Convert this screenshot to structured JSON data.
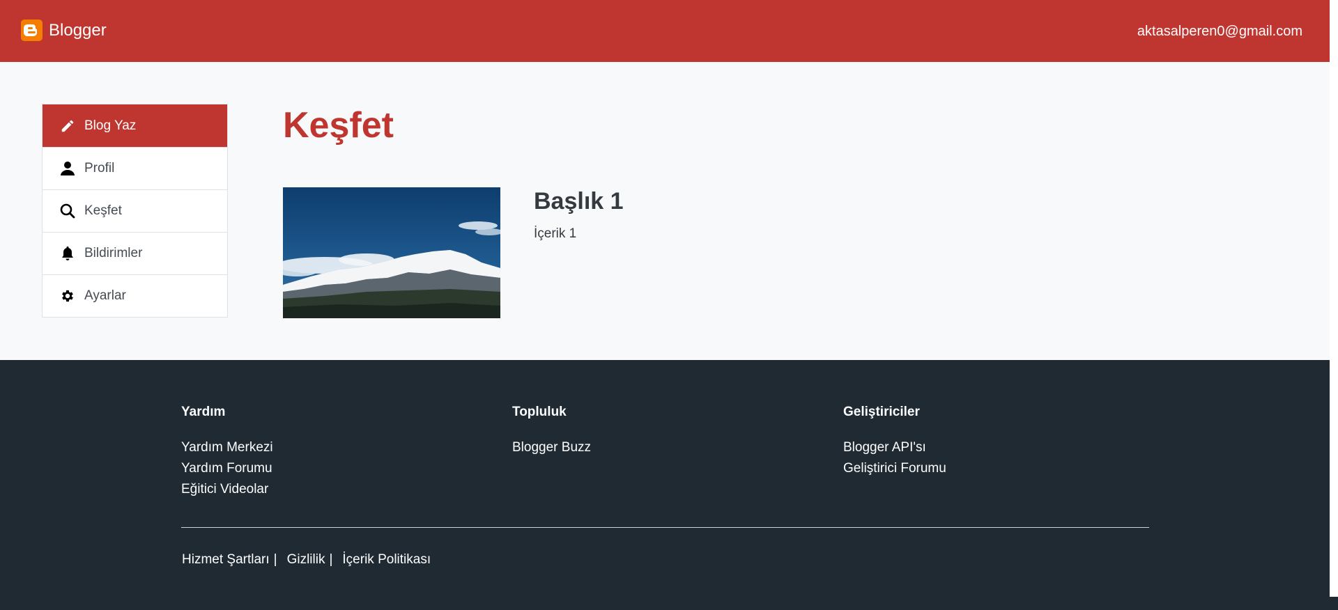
{
  "header": {
    "brand": "Blogger",
    "logo_icon": "blogger-logo-icon",
    "user_email": "aktasalperen0@gmail.com",
    "bg_color": "#bf3630"
  },
  "sidebar": {
    "items": [
      {
        "label": "Blog Yaz",
        "icon": "pencil-icon",
        "active": true
      },
      {
        "label": "Profil",
        "icon": "person-icon"
      },
      {
        "label": "Keşfet",
        "icon": "search-icon"
      },
      {
        "label": "Bildirimler",
        "icon": "bell-icon"
      },
      {
        "label": "Ayarlar",
        "icon": "gear-icon"
      }
    ]
  },
  "main": {
    "title": "Keşfet",
    "posts": [
      {
        "title": "Başlık 1",
        "content": "İçerik 1",
        "image": "mountain-photo"
      }
    ]
  },
  "footer": {
    "columns": [
      {
        "heading": "Yardım",
        "links": [
          "Yardım Merkezi",
          "Yardım Forumu",
          "Eğitici Videolar"
        ]
      },
      {
        "heading": "Topluluk",
        "links": [
          "Blogger Buzz"
        ]
      },
      {
        "heading": "Geliştiriciler",
        "links": [
          "Blogger API'sı",
          "Geliştirici Forumu"
        ]
      }
    ],
    "bottom_links": [
      "Hizmet Şartları",
      "Gizlilik",
      "İçerik Politikası"
    ],
    "separator": "|",
    "bg_color": "#1f2a33"
  }
}
